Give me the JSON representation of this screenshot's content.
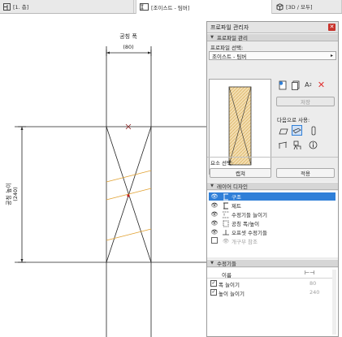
{
  "tabs": [
    {
      "label": "[1. 층]",
      "icon": "floor-plan-icon",
      "active": false
    },
    {
      "label": "[조이스트 - 팀버]",
      "icon": "section-icon",
      "active": true
    },
    {
      "label": "[3D / 모두]",
      "icon": "3d-view-icon",
      "active": false
    }
  ],
  "drawing": {
    "width_dim_label": "공칭 폭",
    "width_dim_value": "(80)",
    "height_dim_label": "공칭 높이",
    "height_dim_value": "(240)"
  },
  "panel": {
    "title": "프로파일 관리자",
    "close_icon": "close-icon",
    "sections": {
      "profile_manage": "프로파일 관리",
      "layer_design": "레이어 디자인",
      "modifiers": "수정기들"
    },
    "profile_select_label": "프로파일 선택:",
    "profile_selected": "조이스트 - 팀버",
    "save_label": "저장",
    "use_with_label": "다음으로 사용:",
    "element_select_label": "요소 선택:",
    "capture_label": "캡쳐",
    "apply_label": "적용",
    "layers": [
      {
        "label": "구조",
        "selected": true,
        "visible": true
      },
      {
        "label": "제트",
        "selected": false,
        "visible": true
      },
      {
        "label": "수정기들 늘이기",
        "selected": false,
        "visible": true
      },
      {
        "label": "공칭 폭/높이",
        "selected": false,
        "visible": true
      },
      {
        "label": "오프셋 수정기들",
        "selected": false,
        "visible": true
      },
      {
        "label": "개구부 참조",
        "selected": false,
        "visible": false
      }
    ],
    "modifier_table": {
      "col_name": "이름",
      "col_value_icon": "width-arrow-icon",
      "rows": [
        {
          "name": "폭 늘이기",
          "value": "80",
          "checked": true
        },
        {
          "name": "높이 늘이기",
          "value": "240",
          "checked": true
        }
      ]
    }
  },
  "colors": {
    "selection": "#2f7fd8",
    "hatch": "#e0a030",
    "delete": "#e03030"
  }
}
